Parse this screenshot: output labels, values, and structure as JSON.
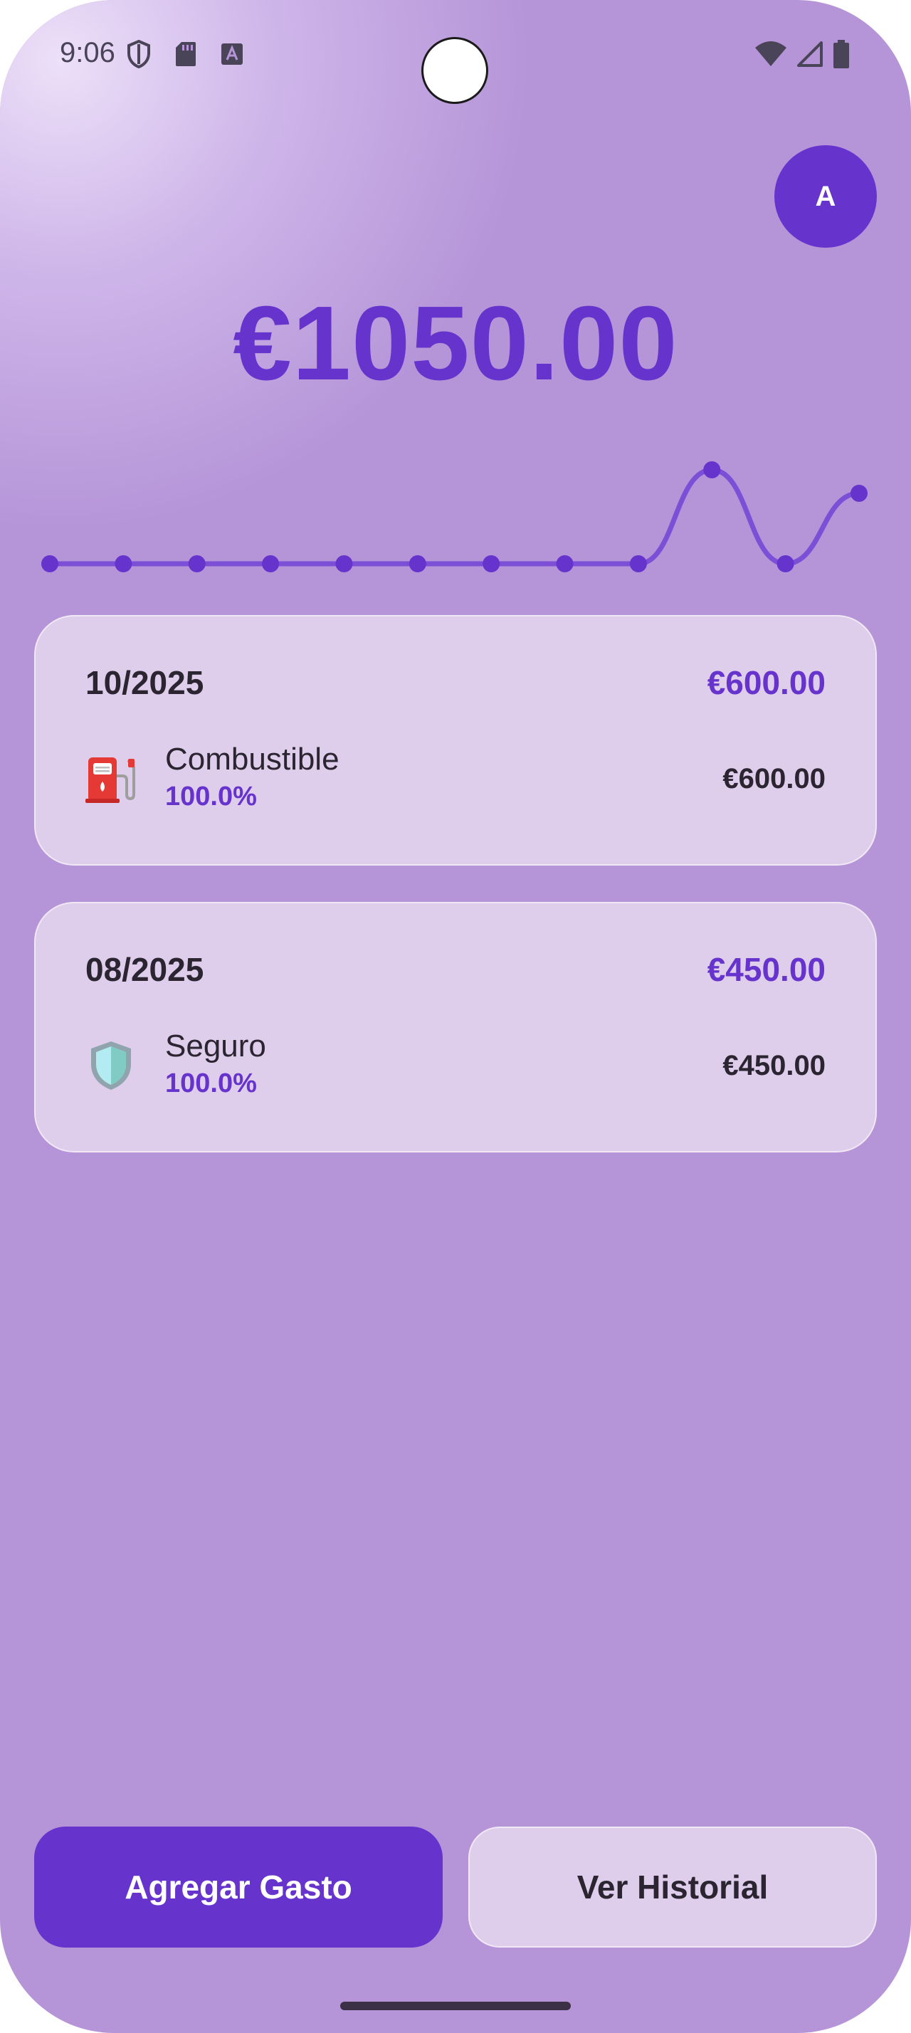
{
  "status_bar": {
    "time": "9:06",
    "left_icons": [
      "shield-icon",
      "sd-card-icon",
      "font-download-icon"
    ],
    "right_icons": [
      "wifi-icon",
      "signal-icon",
      "battery-icon"
    ]
  },
  "avatar": {
    "initial": "A"
  },
  "summary": {
    "total": "€1050.00"
  },
  "chart_data": {
    "type": "line",
    "title": "",
    "series": [
      {
        "values": [
          0,
          0,
          0,
          0,
          0,
          0,
          0,
          0,
          0,
          600,
          0,
          450
        ]
      }
    ],
    "color": "#6633cc",
    "grid": false,
    "ylim": [
      0,
      600
    ]
  },
  "months": [
    {
      "date": "10/2025",
      "total": "€600.00",
      "item": {
        "icon": "fuel-pump-icon",
        "name": "Combustible",
        "percent": "100.0%",
        "amount": "€600.00"
      }
    },
    {
      "date": "08/2025",
      "total": "€450.00",
      "item": {
        "icon": "shield-icon",
        "name": "Seguro",
        "percent": "100.0%",
        "amount": "€450.00"
      }
    }
  ],
  "actions": {
    "add_label": "Agregar Gasto",
    "history_label": "Ver Historial"
  },
  "colors": {
    "accent": "#6633cc",
    "background": "#b595d8",
    "card": "#dfcdec"
  }
}
